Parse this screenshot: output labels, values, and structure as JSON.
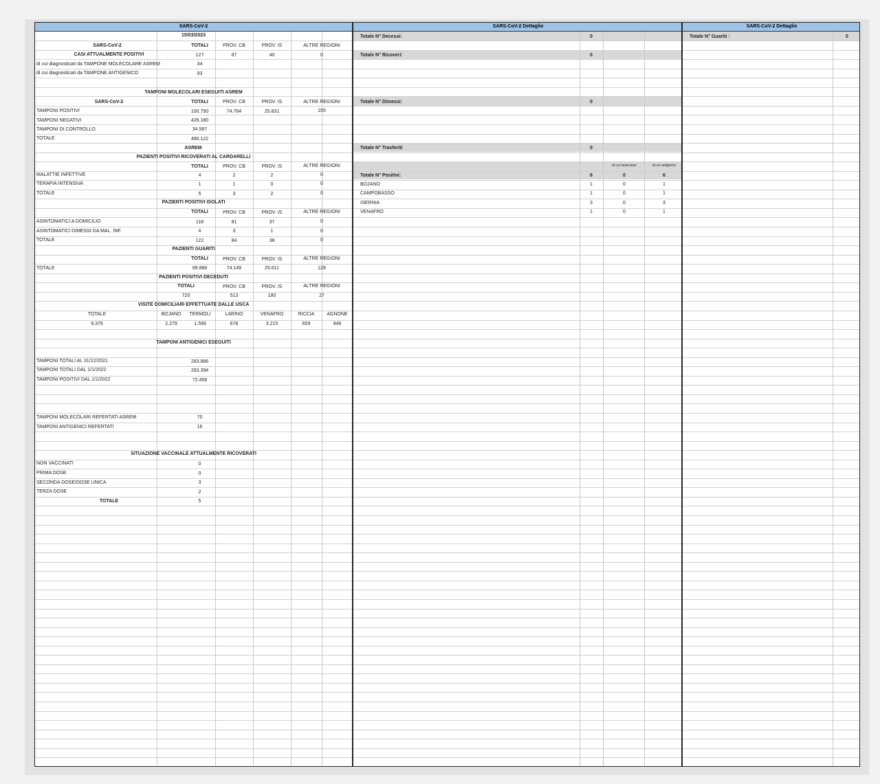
{
  "left": {
    "header": "SARS-CoV-2",
    "date": "15/03/2023",
    "cols": {
      "totali": "TOTALI",
      "prov_cb": "PROV. CB",
      "prov_is": "PROV. IS",
      "altre": "ALTRE REGIONI"
    },
    "casi": {
      "sars_label": "SARS-CoV-2",
      "title": "CASI ATTUALMENTE POSITIVI",
      "values": [
        "127",
        "87",
        "40",
        "0"
      ],
      "rows": [
        {
          "label": "di cui diagnosticati da TAMPONE MOLECOLARE ASREM",
          "value": "34"
        },
        {
          "label": "di cui diagnosticati da TAMPONE ANTIGENICO",
          "value": "93"
        }
      ]
    },
    "molecolari": {
      "title": "TAMPONI MOLECOLARI ESEGUITI ASREM",
      "sars_label": "SARS-CoV-2",
      "rows": [
        {
          "label": "TAMPONI POSITIVI",
          "values": [
            "100.750",
            "74.764",
            "25.831",
            "155"
          ]
        },
        {
          "label": "TAMPONI NEGATIVI",
          "values": [
            "426.180"
          ]
        },
        {
          "label": "TAMPONI DI CONTROLLO",
          "values": [
            "34.587"
          ]
        },
        {
          "label": "TOTALE",
          "values": [
            "490.122"
          ]
        }
      ]
    },
    "asrem": "ASREM",
    "cardarelli": {
      "title": "PAZIENTI POSITIVI RICOVERATI AL CARDARELLI",
      "rows": [
        {
          "label": "MALATTIE INFETTIVE",
          "values": [
            "4",
            "2",
            "2",
            "0"
          ]
        },
        {
          "label": "TERAPIA INTENSIVA",
          "values": [
            "1",
            "1",
            "0",
            "0"
          ]
        },
        {
          "label": "TOTALE",
          "values": [
            "5",
            "3",
            "2",
            "0"
          ]
        }
      ]
    },
    "isolati": {
      "title": "PAZIENTI POSITIVI ISOLATI",
      "rows": [
        {
          "label": "ASINTOMATICI A DOMICILIO",
          "values": [
            "118",
            "81",
            "37",
            "0"
          ]
        },
        {
          "label": "ASINTOMATICI DIMESSI DA MAL. INF.",
          "values": [
            "4",
            "3",
            "1",
            "0"
          ]
        },
        {
          "label": "TOTALE",
          "values": [
            "122",
            "84",
            "38",
            "0"
          ]
        }
      ]
    },
    "guariti": {
      "title": "PAZIENTI GUARITI",
      "rows": [
        {
          "label": "TOTALE",
          "values": [
            "99.888",
            "74.149",
            "25.611",
            "128"
          ]
        }
      ]
    },
    "deceduti": {
      "title": "PAZIENTI POSITIVI DECEDUTI",
      "values": [
        "720",
        "513",
        "180",
        "27"
      ]
    },
    "usca": {
      "title": "VISITE DOMICILIARI EFFETTUATE DALLE USCA",
      "headers": [
        "TOTALE",
        "BOJANO",
        "TERMOLI",
        "LARINO",
        "VENAFRO",
        "RICCIA",
        "AGNONE"
      ],
      "values": [
        "9.376",
        "2.279",
        "1.599",
        "678",
        "3.215",
        "659",
        "946"
      ]
    },
    "antigenici": {
      "title": "TAMPONI ANTIGENICI ESEGUITI",
      "rows": [
        {
          "label": "TAMPONI TOTALI AL 31/12/2021",
          "value": "283.886"
        },
        {
          "label": "TAMPONI TOTALI DAL 1/1/2022",
          "value": "263.394"
        },
        {
          "label": "TAMPONI POSITIVI DAL 1/1/2022",
          "value": "72.458"
        }
      ]
    },
    "refertati": [
      {
        "label": "TAMPONI MOLECOLARI REFERTATI ASREM",
        "value": "70"
      },
      {
        "label": "TAMPONI ANTIGENICI REFERTATI",
        "value": "16"
      }
    ],
    "vaccinale": {
      "title": "SITUAZIONE VACCINALE ATTUALMENTE RICOVERATI",
      "rows": [
        {
          "label": "NON VACCINATI",
          "value": "0"
        },
        {
          "label": "PRIMA DOSE",
          "value": "0"
        },
        {
          "label": "SECONDA DOSE/DOSE UNICA",
          "value": "3"
        },
        {
          "label": "TERZA DOSE",
          "value": "2"
        }
      ],
      "total_label": "TOTALE",
      "total_value": "5"
    }
  },
  "middle": {
    "header": "SARS-CoV-2 Dettaglio",
    "decessi": {
      "label": "Totale N° Decessi:",
      "value": "0"
    },
    "ricoveri": {
      "label": "Totale N° Ricoveri:",
      "value": "0"
    },
    "dimessi": {
      "label": "Totale N° Dimessi:",
      "value": "0"
    },
    "trasferiti": {
      "label": "Totale N° Trasferiti",
      "value": "0"
    },
    "sub_molecolari": "di cui molecolari",
    "sub_antigenici": "di cui antigenici",
    "positivi": {
      "label": "Totale N° Positivi:",
      "values": [
        "6",
        "0",
        "6"
      ]
    },
    "comuni": [
      {
        "name": "BOJANO",
        "values": [
          "1",
          "0",
          "1"
        ]
      },
      {
        "name": "CAMPOBASSO",
        "values": [
          "1",
          "0",
          "1"
        ]
      },
      {
        "name": "ISERNIA",
        "values": [
          "3",
          "0",
          "3"
        ]
      },
      {
        "name": "VENAFRO",
        "values": [
          "1",
          "0",
          "1"
        ]
      }
    ]
  },
  "right": {
    "header": "SARS-CoV-2 Dettaglio",
    "guariti": {
      "label": "Totale N° Guariti :",
      "value": "0"
    }
  }
}
